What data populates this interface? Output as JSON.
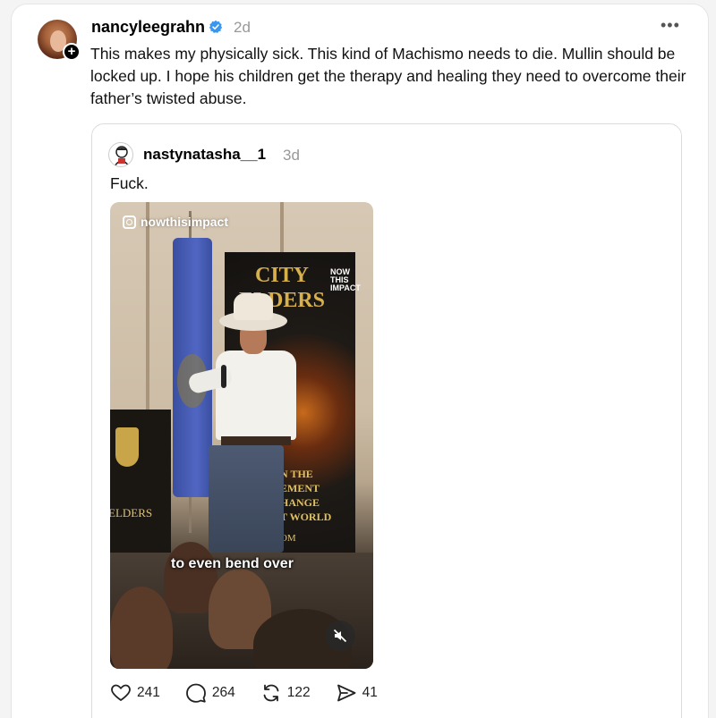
{
  "post": {
    "username": "nancyleegrahn",
    "time": "2d",
    "follow_symbol": "+",
    "more_label": "•••",
    "text": "This makes my physically sick. This kind of Machismo needs to die. Mullin should be locked up. I hope his children get the therapy and healing they need to overcome their father’s twisted abuse."
  },
  "quoted_post": {
    "username": "nastynatasha__1",
    "time": "3d",
    "text": "Fuck.",
    "video": {
      "watermark": "nowthisimpact",
      "caption": "to even bend over",
      "banner_title": "CITY ELDERS",
      "banner_now": "NOW THIS IMPACT",
      "banner_lines": [
        "N THE",
        "EMENT",
        "HANGE",
        "T   WORLD"
      ],
      "banner_url": "CI   DERS.COM",
      "podium_text": "ELDERS"
    },
    "actions": {
      "likes": "241",
      "replies": "264",
      "reposts": "122",
      "shares": "41"
    }
  },
  "icons": {
    "verified": "verified-check-icon",
    "like": "heart-icon",
    "reply": "speech-bubble-icon",
    "repost": "repost-icon",
    "share": "send-icon",
    "mute": "muted-speaker-icon",
    "instagram": "instagram-icon"
  },
  "colors": {
    "verified_blue": "#3897f0",
    "muted_text": "#999999"
  }
}
